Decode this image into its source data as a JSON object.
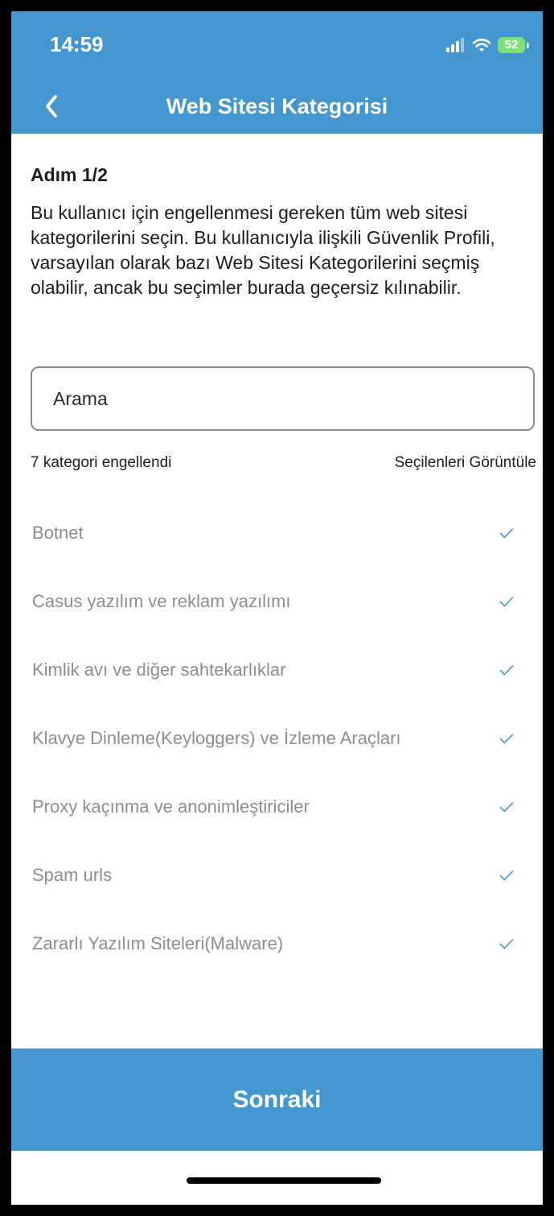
{
  "status_bar": {
    "time": "14:59",
    "battery": "52",
    "colors": {
      "battery": "#7fe07a"
    }
  },
  "header": {
    "title": "Web Sitesi Kategorisi",
    "back_icon": "chevron-left-icon"
  },
  "content": {
    "step": "Adım 1/2",
    "description": "Bu kullanıcı için engellenmesi gereken tüm web sitesi kategorilerini seçin. Bu kullanıcıyla ilişkili Güvenlik Profili, varsayılan olarak bazı Web Sitesi Kategorilerini seçmiş olabilir, ancak bu seçimler burada geçersiz kılınabilir.",
    "search_placeholder": "Arama",
    "count_label": "7 kategori engellendi",
    "view_selected_label": "Seçilenleri Görüntüle",
    "categories": [
      {
        "label": "Botnet",
        "checked": true
      },
      {
        "label": "Casus yazılım ve reklam yazılımı",
        "checked": true
      },
      {
        "label": "Kimlik avı ve diğer sahtekarlıklar",
        "checked": true
      },
      {
        "label": "Klavye Dinleme(Keyloggers) ve İzleme Araçları",
        "checked": true
      },
      {
        "label": "Proxy kaçınma ve anonimleştiriciler",
        "checked": true
      },
      {
        "label": "Spam urls",
        "checked": true
      },
      {
        "label": "Zararlı Yazılım Siteleri(Malware)",
        "checked": true
      }
    ]
  },
  "footer": {
    "next_label": "Sonraki"
  },
  "colors": {
    "primary": "#4496ce",
    "check": "#4496ce",
    "muted_text": "#8d8d8d"
  }
}
